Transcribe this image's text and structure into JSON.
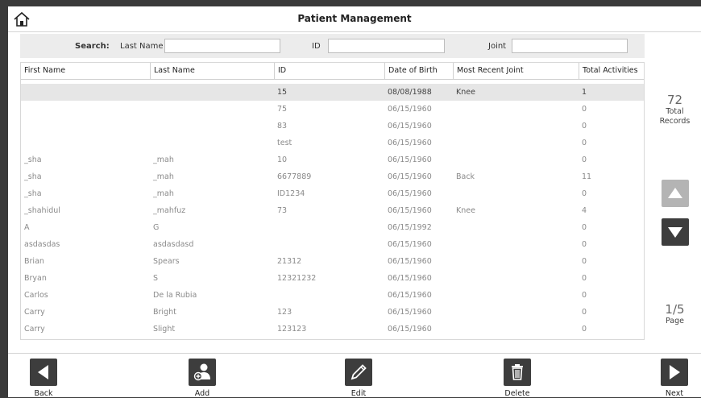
{
  "header": {
    "title": "Patient Management"
  },
  "search": {
    "label": "Search:",
    "last_name_label": "Last Name",
    "last_name_value": "",
    "id_label": "ID",
    "id_value": "",
    "joint_label": "Joint",
    "joint_value": ""
  },
  "table": {
    "columns": [
      "First Name",
      "Last Name",
      "ID",
      "Date of Birth",
      "Most Recent Joint",
      "Total Activities"
    ],
    "rows": [
      [
        "",
        "",
        "15",
        "08/08/1988",
        "Knee",
        "1"
      ],
      [
        "",
        "",
        "75",
        "06/15/1960",
        "",
        "0"
      ],
      [
        "",
        "",
        "83",
        "06/15/1960",
        "",
        "0"
      ],
      [
        "",
        "",
        "test",
        "06/15/1960",
        "",
        "0"
      ],
      [
        "_sha",
        "_mah",
        "10",
        "06/15/1960",
        "",
        "0"
      ],
      [
        "_sha",
        "_mah",
        "6677889",
        "06/15/1960",
        "Back",
        "11"
      ],
      [
        "_sha",
        "_mah",
        "ID1234",
        "06/15/1960",
        "",
        "0"
      ],
      [
        "_shahidul",
        "_mahfuz",
        "73",
        "06/15/1960",
        "Knee",
        "4"
      ],
      [
        "A",
        "G",
        "",
        "06/15/1992",
        "",
        "0"
      ],
      [
        "asdasdas",
        "asdasdasd",
        "",
        "06/15/1960",
        "",
        "0"
      ],
      [
        "Brian",
        "Spears",
        "21312",
        "06/15/1960",
        "",
        "0"
      ],
      [
        "Bryan",
        "S",
        "12321232",
        "06/15/1960",
        "",
        "0"
      ],
      [
        "Carlos",
        "De la Rubia",
        "",
        "06/15/1960",
        "",
        "0"
      ],
      [
        "Carry",
        "Bright",
        "123",
        "06/15/1960",
        "",
        "0"
      ],
      [
        "Carry",
        "Slight",
        "123123",
        "06/15/1960",
        "",
        "0"
      ]
    ]
  },
  "summary": {
    "total": "72",
    "total_label_1": "Total",
    "total_label_2": "Records"
  },
  "pagination": {
    "page": "1/5",
    "page_label": "Page"
  },
  "toolbar": {
    "back_label": "Back",
    "add_label": "Add",
    "edit_label": "Edit",
    "delete_label": "Delete",
    "next_label": "Next"
  },
  "icons": [
    "home-icon",
    "up-arrow-icon",
    "down-arrow-icon",
    "back-arrow-icon",
    "add-user-icon",
    "pencil-icon",
    "trash-icon",
    "next-arrow-icon"
  ]
}
